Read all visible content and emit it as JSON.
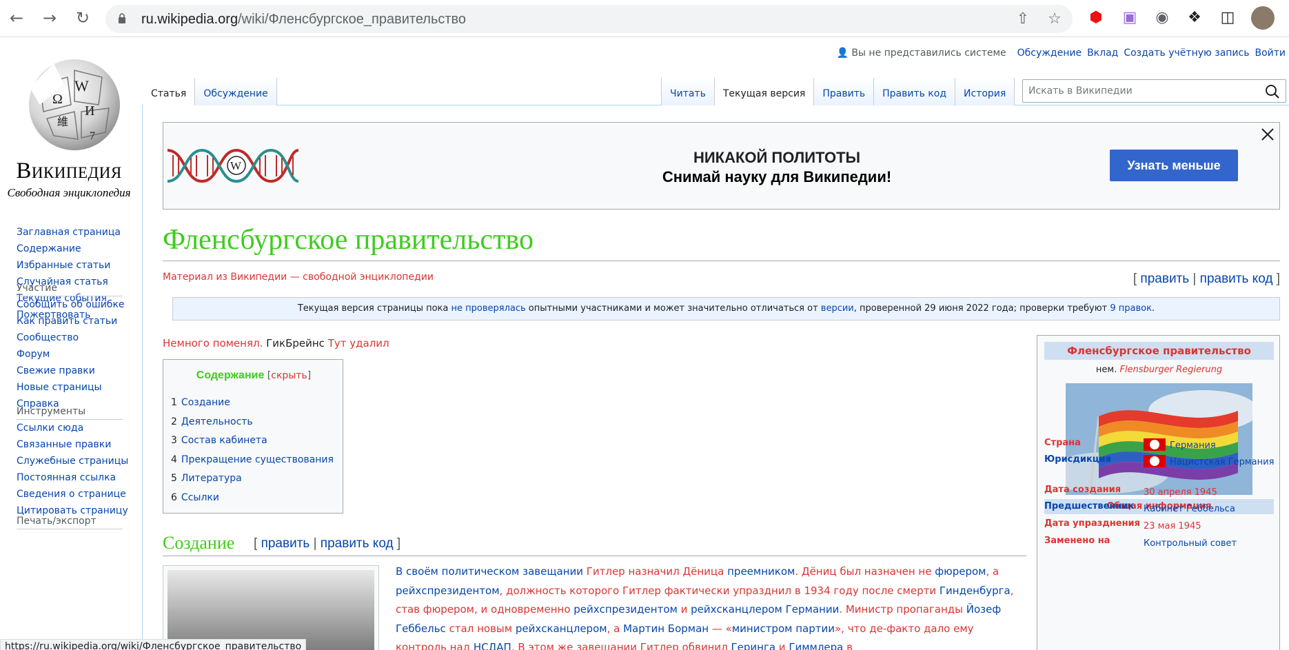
{
  "browser": {
    "url_domain": "ru.wikipedia.org",
    "url_path": "/wiki/Фленсбургское_правительство",
    "status_url": "https://ru.wikipedia.org/wiki/Фленсбургское_правительство"
  },
  "logo": {
    "wordmark": "Википедия",
    "tagline": "Свободная энциклопедия"
  },
  "personal": {
    "not_logged": "Вы не представились системе",
    "items": [
      "Обсуждение",
      "Вклад",
      "Создать учётную запись",
      "Войти"
    ]
  },
  "tabs_left": [
    "Статья",
    "Обсуждение"
  ],
  "tabs_right": [
    "Читать",
    "Текущая версия",
    "Править",
    "Править код",
    "История"
  ],
  "search": {
    "placeholder": "Искать в Википедии"
  },
  "sidebar": {
    "main": [
      "Заглавная страница",
      "Содержание",
      "Избранные статьи",
      "Случайная статья",
      "Текущие события",
      "Пожертвовать"
    ],
    "participation_head": "Участие",
    "participation": [
      "Сообщить об ошибке",
      "Как править статьи",
      "Сообщество",
      "Форум",
      "Свежие правки",
      "Новые страницы",
      "Справка"
    ],
    "tools_head": "Инструменты",
    "tools": [
      "Ссылки сюда",
      "Связанные правки",
      "Служебные страницы",
      "Постоянная ссылка",
      "Сведения о странице",
      "Цитировать страницу"
    ],
    "print_head": "Печать/экспорт"
  },
  "banner": {
    "line1": "НИКАКОЙ ПОЛИТОТЫ",
    "line2": "Снимай науку для Википедии!",
    "button": "Узнать меньше"
  },
  "article": {
    "title": "Фленсбургское правительство",
    "site_sub": "Материал из Википедии — свободной энциклопедии",
    "edit": "править",
    "edit_code": "править код",
    "notice_a": "Текущая версия страницы пока ",
    "notice_link1": "не проверялась",
    "notice_b": " опытными участниками и может значительно отличаться от ",
    "notice_link2": "версии",
    "notice_c": ", проверенной 29 июня 2022 года; проверки требуют ",
    "notice_link3": "9 правок",
    "notice_d": ".",
    "intro_a": "Немного поменял.",
    "intro_b": " ГикБрейнс",
    "intro_c": " Тут удалил",
    "toc_title": "Содержание",
    "toc_hide": "скрыть",
    "toc": [
      {
        "num": "1",
        "label": "Создание"
      },
      {
        "num": "2",
        "label": "Деятельность"
      },
      {
        "num": "3",
        "label": "Состав кабинета"
      },
      {
        "num": "4",
        "label": "Прекращение существования"
      },
      {
        "num": "5",
        "label": "Литература"
      },
      {
        "num": "6",
        "label": "Ссылки"
      }
    ],
    "section1": "Создание",
    "para": [
      {
        "t": "В своём политическом завещании ",
        "c": "link"
      },
      {
        "t": "Гитлер",
        "c": "red"
      },
      {
        "t": " назначил Дёница ",
        "c": "red"
      },
      {
        "t": "преемником",
        "c": "link"
      },
      {
        "t": ". Дёниц был назначен не ",
        "c": "red"
      },
      {
        "t": "фюрером",
        "c": "link"
      },
      {
        "t": ", а ",
        "c": "red"
      },
      {
        "t": "рейхспрезидентом",
        "c": "link"
      },
      {
        "t": ", должность которого Гитлер фактически упразднил в 1934 году после смерти ",
        "c": "red"
      },
      {
        "t": "Гинденбурга",
        "c": "link"
      },
      {
        "t": ", став фюрером, и одновременно ",
        "c": "red"
      },
      {
        "t": "рейхспрезидентом",
        "c": "link"
      },
      {
        "t": " и ",
        "c": "red"
      },
      {
        "t": "рейхсканцлером Германии",
        "c": "link"
      },
      {
        "t": ". Министр пропаганды ",
        "c": "red"
      },
      {
        "t": "Йозеф Геббельс",
        "c": "link"
      },
      {
        "t": " стал новым ",
        "c": "red"
      },
      {
        "t": "рейхсканцлером",
        "c": "link"
      },
      {
        "t": ", а ",
        "c": "red"
      },
      {
        "t": "Мартин Борман",
        "c": "link"
      },
      {
        "t": " — «",
        "c": "red"
      },
      {
        "t": "министром партии",
        "c": "link"
      },
      {
        "t": "», что де-факто дало ему контроль над ",
        "c": "red"
      },
      {
        "t": "НСДАП",
        "c": "link"
      },
      {
        "t": ". В этом же завещании Гитлер обвинил ",
        "c": "red"
      },
      {
        "t": "Геринга",
        "c": "link"
      },
      {
        "t": " и ",
        "c": "red"
      },
      {
        "t": "Гиммлера",
        "c": "link"
      },
      {
        "t": " в",
        "c": "red"
      }
    ]
  },
  "infobox": {
    "title": "Фленсбургское правительство",
    "native_prefix": "нем.",
    "native_name": "Flensburger Regierung",
    "section": "Общая информация",
    "rows": [
      {
        "k": "Страна",
        "v": "Германия"
      },
      {
        "k": "Юрисдикция",
        "v": "Нацистская Германия"
      },
      {
        "k": "Дата создания",
        "v": "30 апреля 1945"
      },
      {
        "k": "Предшественник",
        "v": "Кабинет Геббельса"
      },
      {
        "k": "Дата упразднения",
        "v": "23 мая 1945"
      },
      {
        "k": "Заменено на",
        "v": "Контрольный совет"
      }
    ]
  }
}
